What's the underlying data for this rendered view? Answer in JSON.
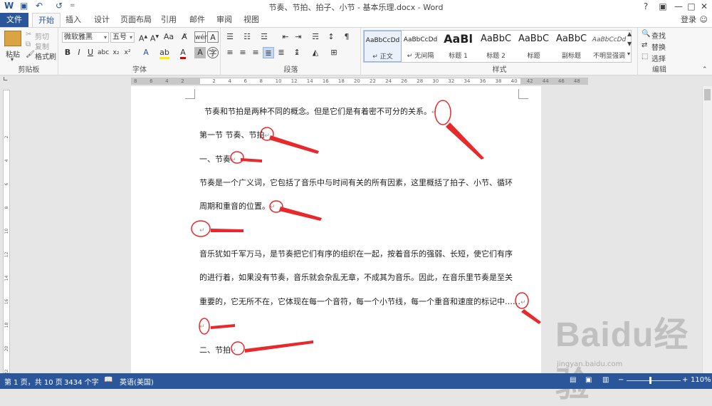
{
  "window": {
    "title": "节奏、节拍、拍子、小节 - 基本乐理.docx - Word",
    "help": "?",
    "minimize": "—",
    "maximize": "□",
    "close": "✕"
  },
  "quick_access": {
    "save": "💾",
    "undo": "↶",
    "redo": "↺",
    "customize": "="
  },
  "tabs": [
    "文件",
    "开始",
    "插入",
    "设计",
    "页面布局",
    "引用",
    "邮件",
    "审阅",
    "视图"
  ],
  "login": "登录",
  "ribbon": {
    "clipboard": {
      "paste": "粘贴",
      "cut": "剪切",
      "copy": "复制",
      "format_painter": "格式刷",
      "label": "剪贴板"
    },
    "font": {
      "font_name": "微软雅黑",
      "font_size": "五号",
      "label": "字体"
    },
    "paragraph": {
      "label": "段落"
    },
    "styles": {
      "label": "样式",
      "items": [
        {
          "sample": "AaBbCcDd",
          "name": "↵ 正文"
        },
        {
          "sample": "AaBbCcDd",
          "name": "↵ 无间隔"
        },
        {
          "sample": "AaBl",
          "name": "标题 1"
        },
        {
          "sample": "AaBbC",
          "name": "标题 2"
        },
        {
          "sample": "AaBbC",
          "name": "标题"
        },
        {
          "sample": "AaBbC",
          "name": "副标题"
        },
        {
          "sample": "AaBbCcDd",
          "name": "不明显强调"
        }
      ]
    },
    "editing": {
      "find": "查找",
      "replace": "替换",
      "select": "选择",
      "label": "编辑"
    }
  },
  "ruler": {
    "ticks": [
      "8",
      "6",
      "4",
      "2",
      "",
      "2",
      "4",
      "6",
      "8",
      "10",
      "12",
      "14",
      "16",
      "18",
      "20",
      "22",
      "24",
      "26",
      "28",
      "30",
      "32",
      "34",
      "36",
      "38",
      "40",
      "42",
      "44",
      "46",
      "48"
    ]
  },
  "vruler": {
    "ticks": [
      "2",
      "4",
      "6",
      "8",
      "10",
      "12",
      "14",
      "16",
      "18",
      "20",
      "22"
    ]
  },
  "document": {
    "lines": [
      "节奏和节拍是两种不同的概念。但是它们是有着密不可分的关系。",
      "第一节 节奏、节拍",
      "一、节奏",
      "节奏是一个广义词，它包括了音乐中与时间有关的所有因素，这里概括了拍子、小节、循环",
      "周期和重音的位置。",
      "",
      "音乐犹如千军万马，是节奏把它们有序的组织在一起，按着音乐的强弱、长短，使它们有序",
      "的进行着，如果没有节奏，音乐就会杂乱无章，不成其为音乐。因此，在音乐里节奏是至关",
      "重要的，它无所不在，它体现在每一个音符，每一个小节线，每一个重音和速度的标记中……",
      "",
      "二、节拍"
    ],
    "paragraph_mark": "↵"
  },
  "status": {
    "page": "第 1 页，共 10 页",
    "words": "3434 个字",
    "language": "英语(美国)",
    "zoom": "110%"
  },
  "watermark": {
    "brand": "Baidu经验",
    "url": "jingyan.baidu.com"
  },
  "colors": {
    "accent": "#2b579a",
    "annotation": "#e8282b"
  }
}
